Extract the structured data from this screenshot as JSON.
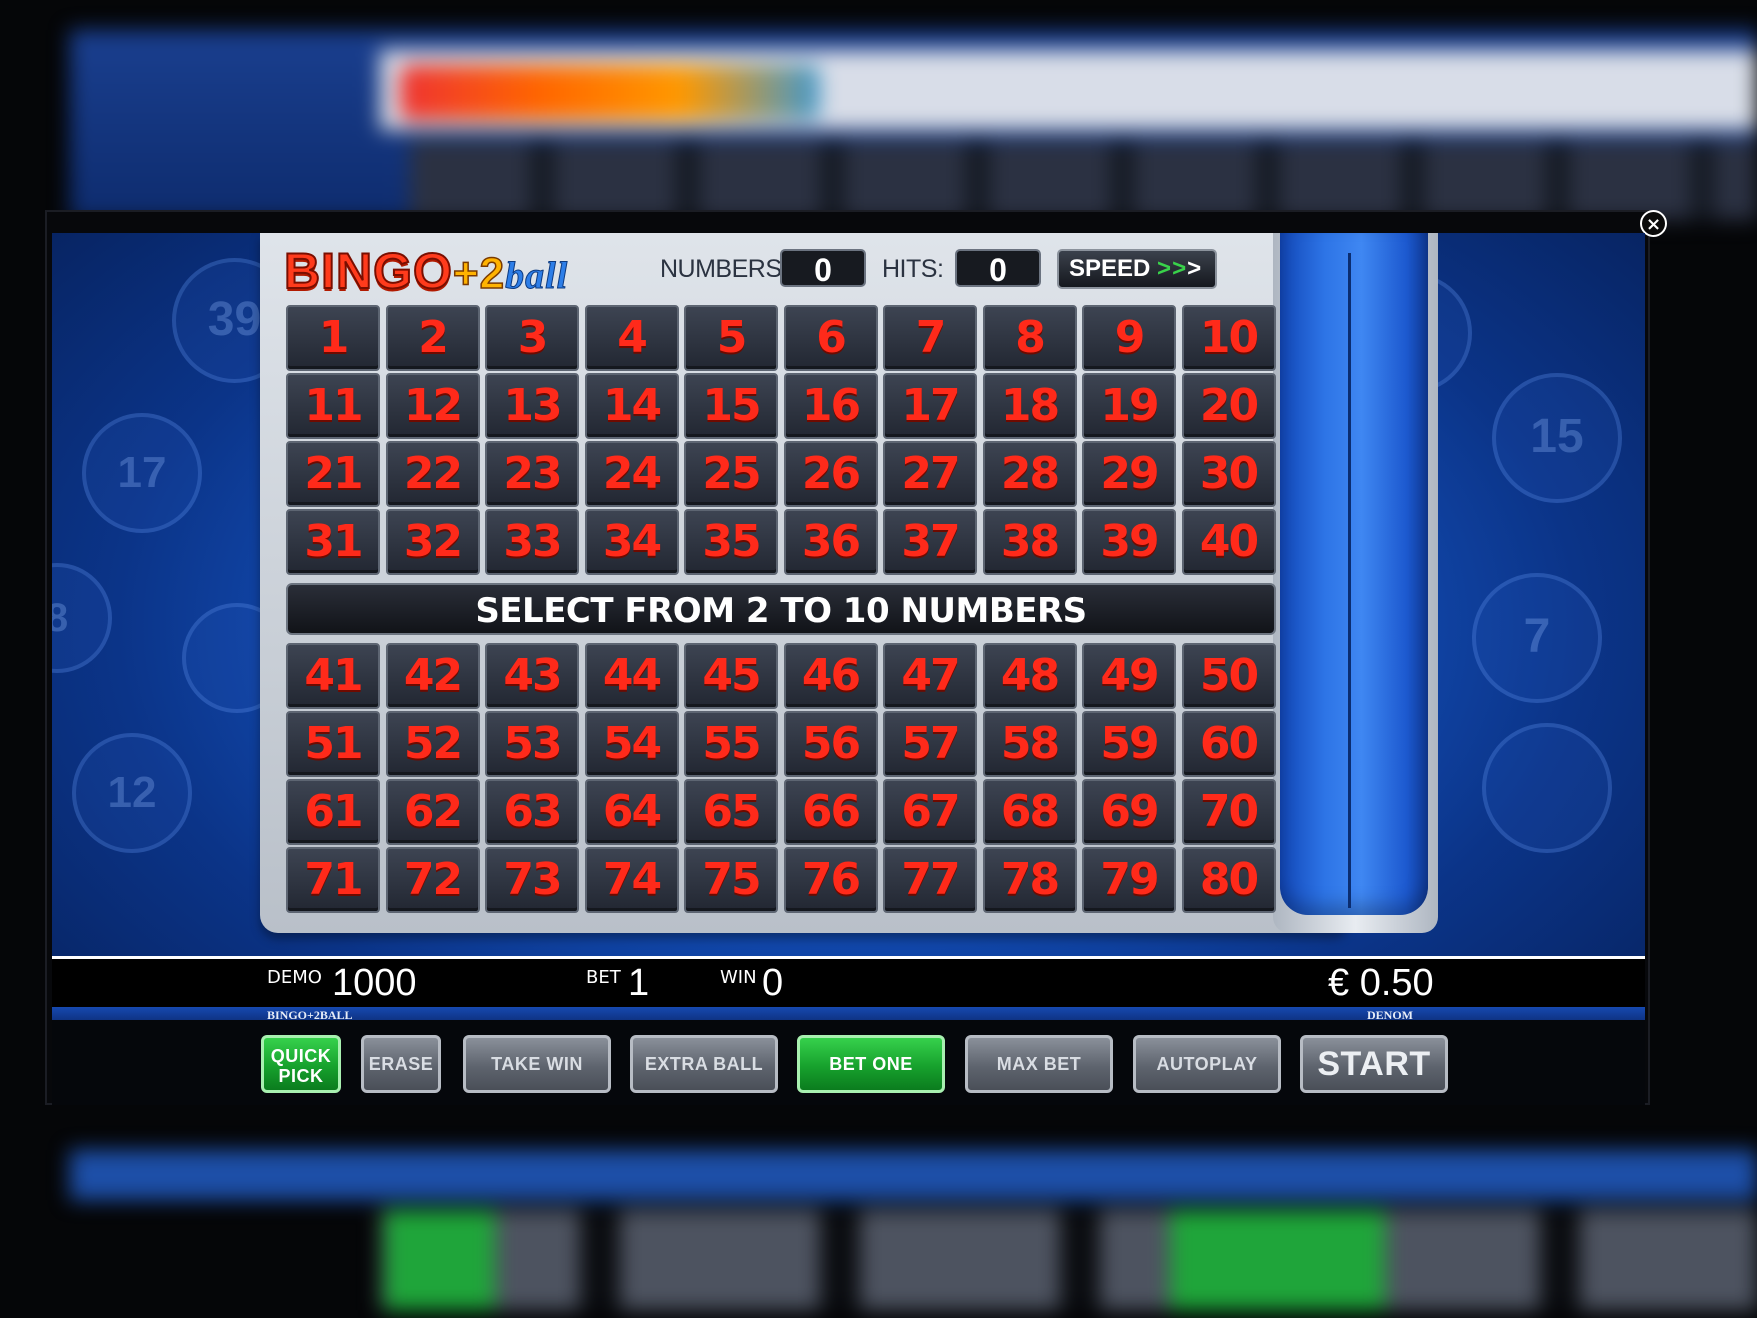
{
  "game": {
    "logo": {
      "bingo": "BINGO",
      "plus": "+2",
      "ball": "ball"
    },
    "numbers_label": "NUMBERS:",
    "numbers_value": "0",
    "hits_label": "HITS:",
    "hits_value": "0",
    "speed_label": "SPEED",
    "speed_arrows": ">>",
    "speed_last_arrow": ">",
    "message": "SELECT FROM 2 TO 10 NUMBERS",
    "grid_top": [
      1,
      2,
      3,
      4,
      5,
      6,
      7,
      8,
      9,
      10,
      11,
      12,
      13,
      14,
      15,
      16,
      17,
      18,
      19,
      20,
      21,
      22,
      23,
      24,
      25,
      26,
      27,
      28,
      29,
      30,
      31,
      32,
      33,
      34,
      35,
      36,
      37,
      38,
      39,
      40
    ],
    "grid_bottom": [
      41,
      42,
      43,
      44,
      45,
      46,
      47,
      48,
      49,
      50,
      51,
      52,
      53,
      54,
      55,
      56,
      57,
      58,
      59,
      60,
      61,
      62,
      63,
      64,
      65,
      66,
      67,
      68,
      69,
      70,
      71,
      72,
      73,
      74,
      75,
      76,
      77,
      78,
      79,
      80
    ],
    "deco_balls": [
      "39",
      "17",
      "12",
      "15",
      "7",
      "8"
    ]
  },
  "status": {
    "demo_label": "DEMO",
    "demo_value": "1000",
    "bet_label": "BET",
    "bet_value": "1",
    "win_label": "WIN",
    "win_value": "0",
    "denom_value": "€ 0.50",
    "game_name": "BINGO+2BALL",
    "denom_label": "DENOM"
  },
  "buttons": {
    "quick_pick_1": "QUICK",
    "quick_pick_2": "PICK",
    "erase": "ERASE",
    "take_win": "TAKE WIN",
    "extra_ball": "EXTRA BALL",
    "bet_one": "BET ONE",
    "max_bet": "MAX BET",
    "autoplay": "AUTOPLAY",
    "start": "START"
  },
  "close_symbol": "×",
  "colors": {
    "number_red": "#ff2a1a",
    "button_green": "#17a12d",
    "bg_blue": "#1554c2"
  }
}
